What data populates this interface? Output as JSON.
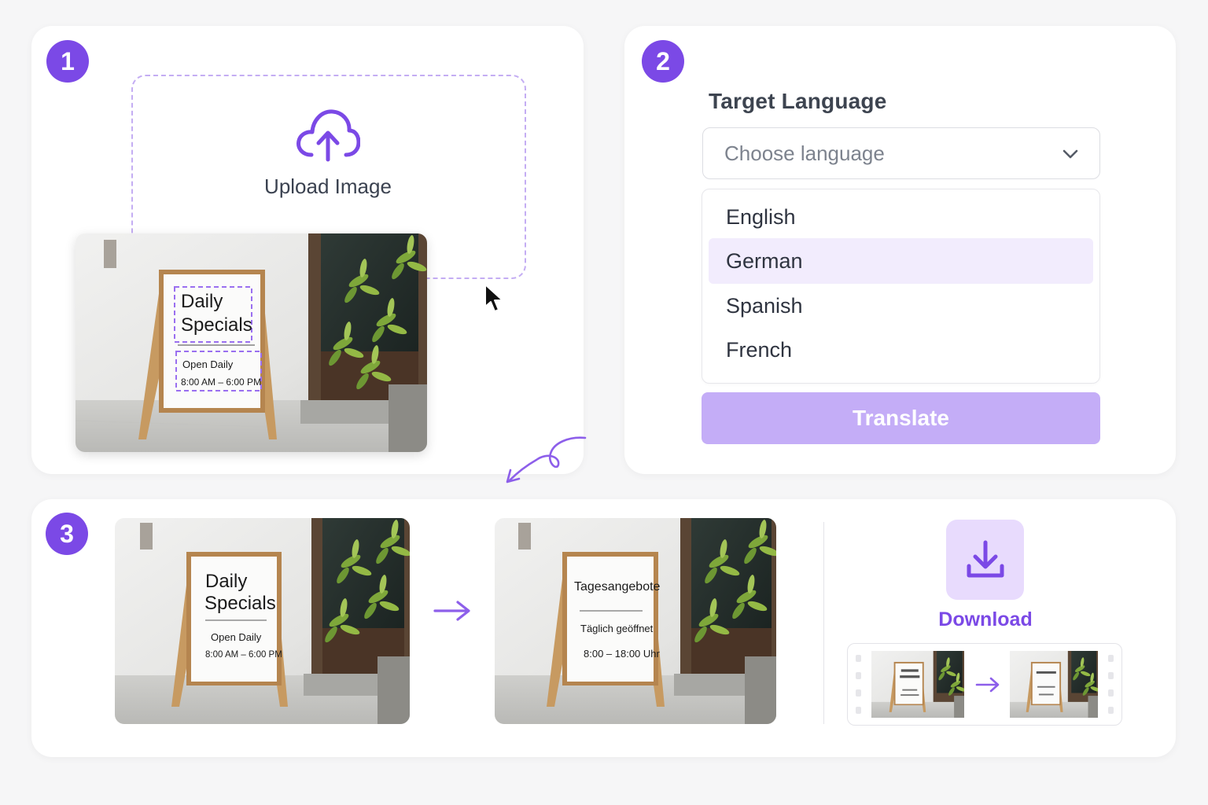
{
  "steps": {
    "one": "1",
    "two": "2",
    "three": "3"
  },
  "upload": {
    "label": "Upload Image",
    "preview": {
      "title_line1": "Daily",
      "title_line2": "Specials",
      "sub_line1": "Open Daily",
      "sub_line2": "8:00 AM – 6:00 PM"
    }
  },
  "language": {
    "label": "Target Language",
    "placeholder": "Choose language",
    "options": [
      {
        "label": "English",
        "selected": false
      },
      {
        "label": "German",
        "selected": true
      },
      {
        "label": "Spanish",
        "selected": false
      },
      {
        "label": "French",
        "selected": false
      }
    ],
    "translate_label": "Translate"
  },
  "result": {
    "original": {
      "title_line1": "Daily",
      "title_line2": "Specials",
      "sub_line1": "Open Daily",
      "sub_line2": "8:00 AM – 6:00 PM"
    },
    "translated": {
      "title_line1": "Tagesangebote",
      "sub_line1": "Täglich geöffnet",
      "sub_line2": "8:00 – 18:00 Uhr"
    },
    "download_label": "Download"
  },
  "colors": {
    "accent": "#7b49e6",
    "accent_light": "#c4adf7",
    "selected_bg": "#f2ecfd"
  },
  "icons": [
    "cloud-upload-icon",
    "chevron-down-icon",
    "cursor-icon",
    "curved-arrow-icon",
    "arrow-right-icon",
    "download-icon"
  ]
}
